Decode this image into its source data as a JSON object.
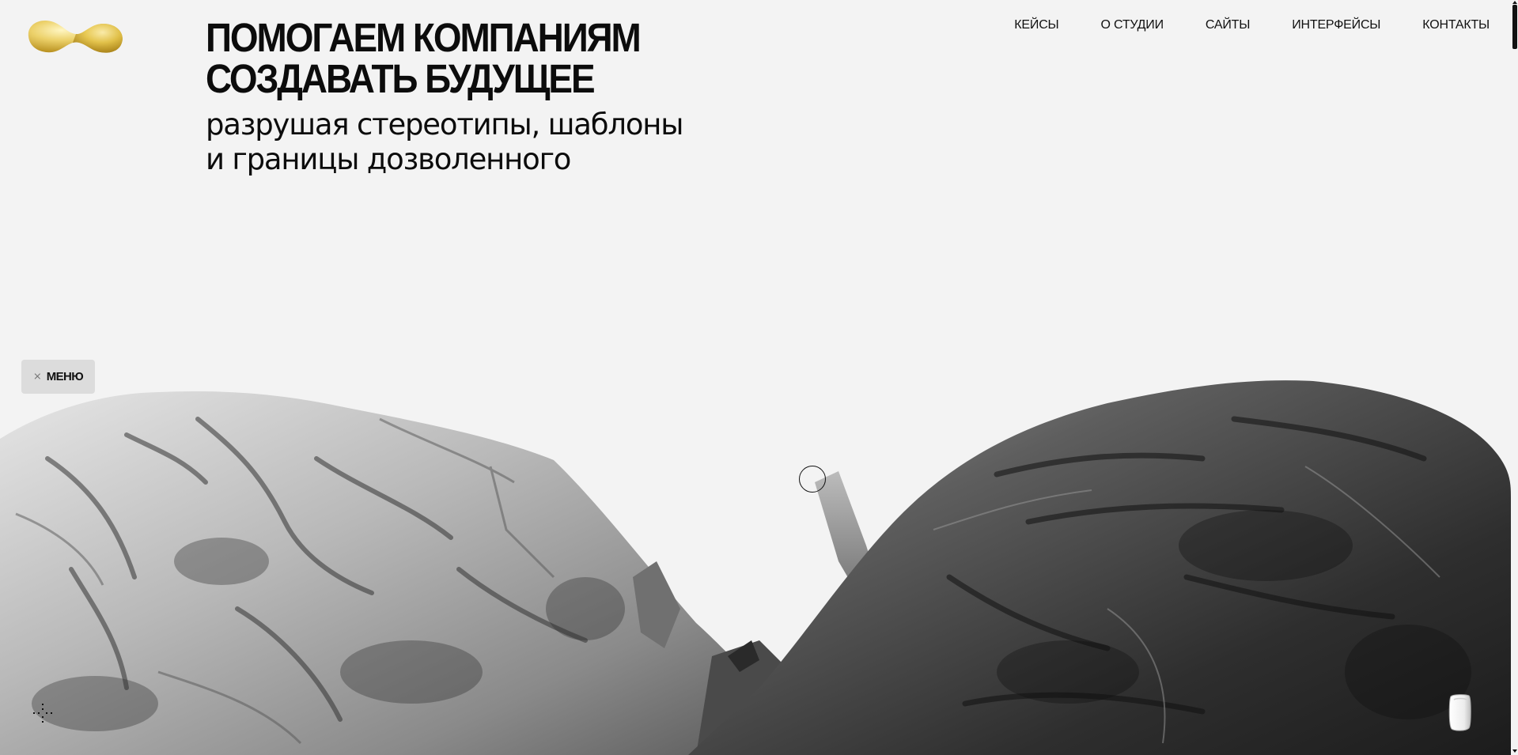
{
  "hero": {
    "title_lines": [
      "ПОМОГАЕМ КОМПАНИЯМ",
      "СОЗДАВАТЬ БУДУЩЕЕ"
    ],
    "subtitle_lines": [
      "разрушая стереотипы, шаблоны",
      "и границы дозволенного"
    ]
  },
  "nav": {
    "items": [
      {
        "label": "КЕЙСЫ"
      },
      {
        "label": "О СТУДИИ"
      },
      {
        "label": "САЙТЫ"
      },
      {
        "label": "ИНТЕРФЕЙСЫ"
      },
      {
        "label": "КОНТАКТЫ"
      }
    ]
  },
  "menu_button": {
    "label": "МЕНЮ",
    "icon": "close-x-icon"
  },
  "icons": {
    "logo": "yellow-blob-logo",
    "cursor": "circle-cursor-icon",
    "dots": "dots-grid-icon",
    "widget": "chat-widget-icon"
  },
  "colors": {
    "background": "#f3f3f3",
    "text": "#0c0c0c",
    "logo_yellow": "#e8c53a",
    "menu_bg": "#dcdcdc",
    "rock_light": "#cfcfcf",
    "rock_dark": "#2a2a2a"
  }
}
